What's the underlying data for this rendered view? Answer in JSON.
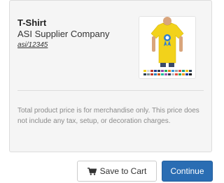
{
  "product": {
    "name": "T-Shirt",
    "supplier": "ASI Supplier Company",
    "supplier_link": "asi/12345"
  },
  "disclaimer": "Total product price is for merchandise only. This price does not include any tax, setup, or decoration charges.",
  "actions": {
    "save_label": "Save to Cart",
    "save_icon": "cart-icon",
    "continue_label": "Continue"
  },
  "colors": {
    "panel_background": "#f5f5f5",
    "continue_background": "#2a6db3",
    "shirt": "#f2d21b",
    "ribbon_badge": "#2f7fd0",
    "disclaimer_text": "#8a8a8a"
  }
}
